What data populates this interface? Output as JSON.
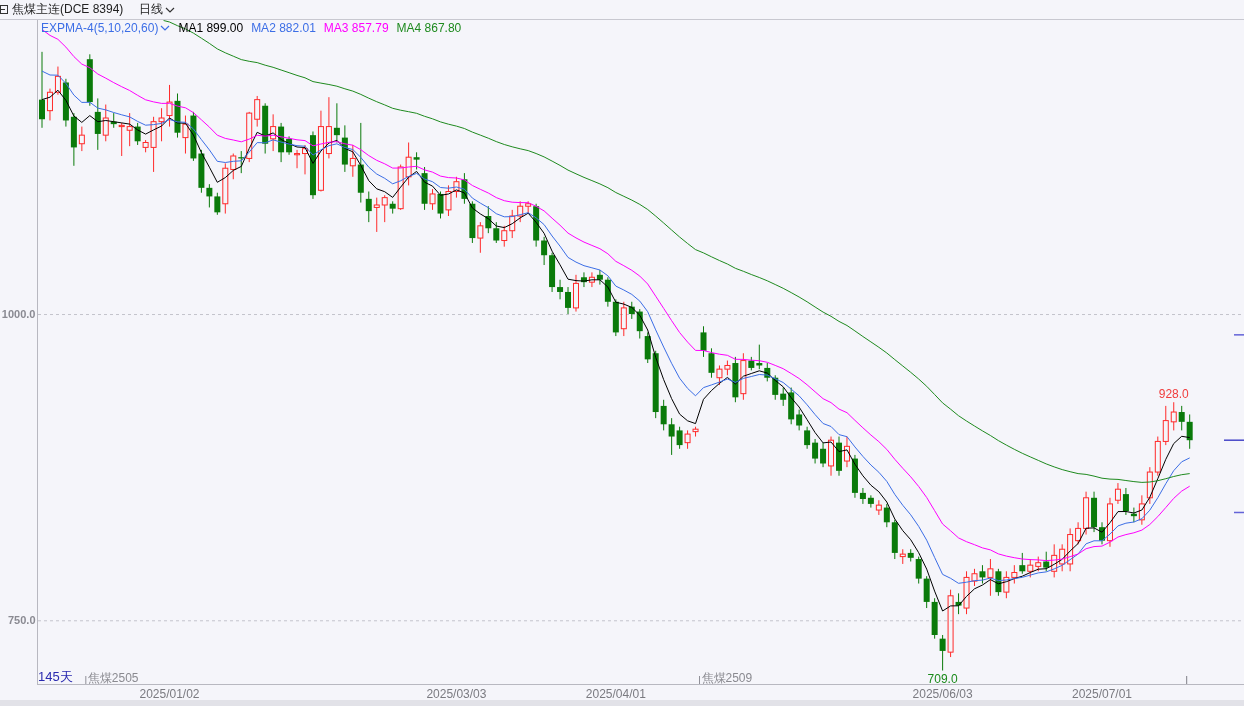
{
  "header": {
    "title": "焦煤主连(DCE 8394)",
    "period": "日线"
  },
  "legend": {
    "indicator": "EXPMA-4(5,10,20,60)",
    "items": [
      {
        "name": "MA1",
        "value": "899.00",
        "color": "#000000"
      },
      {
        "name": "MA2",
        "value": "882.01",
        "color": "#3c6ee6"
      },
      {
        "name": "MA3",
        "value": "857.79",
        "color": "#ff00ff"
      },
      {
        "name": "MA4",
        "value": "867.80",
        "color": "#1e8a1e"
      }
    ]
  },
  "y_axis": {
    "labels": [
      "1000.0",
      "750.0"
    ]
  },
  "x_axis": {
    "labels": [
      "2025/01/02",
      "2025/03/03",
      "2025/04/01",
      "2025/06/03",
      "2025/07/01"
    ]
  },
  "contracts": [
    {
      "label": "焦煤2505"
    },
    {
      "label": "焦煤2509"
    }
  ],
  "extremes": [
    {
      "kind": "high",
      "label": "928.0",
      "color": "#f03c3c"
    },
    {
      "kind": "low",
      "label": "709.0",
      "color": "#1a8a1a"
    }
  ],
  "status": {
    "days": "145天"
  }
}
